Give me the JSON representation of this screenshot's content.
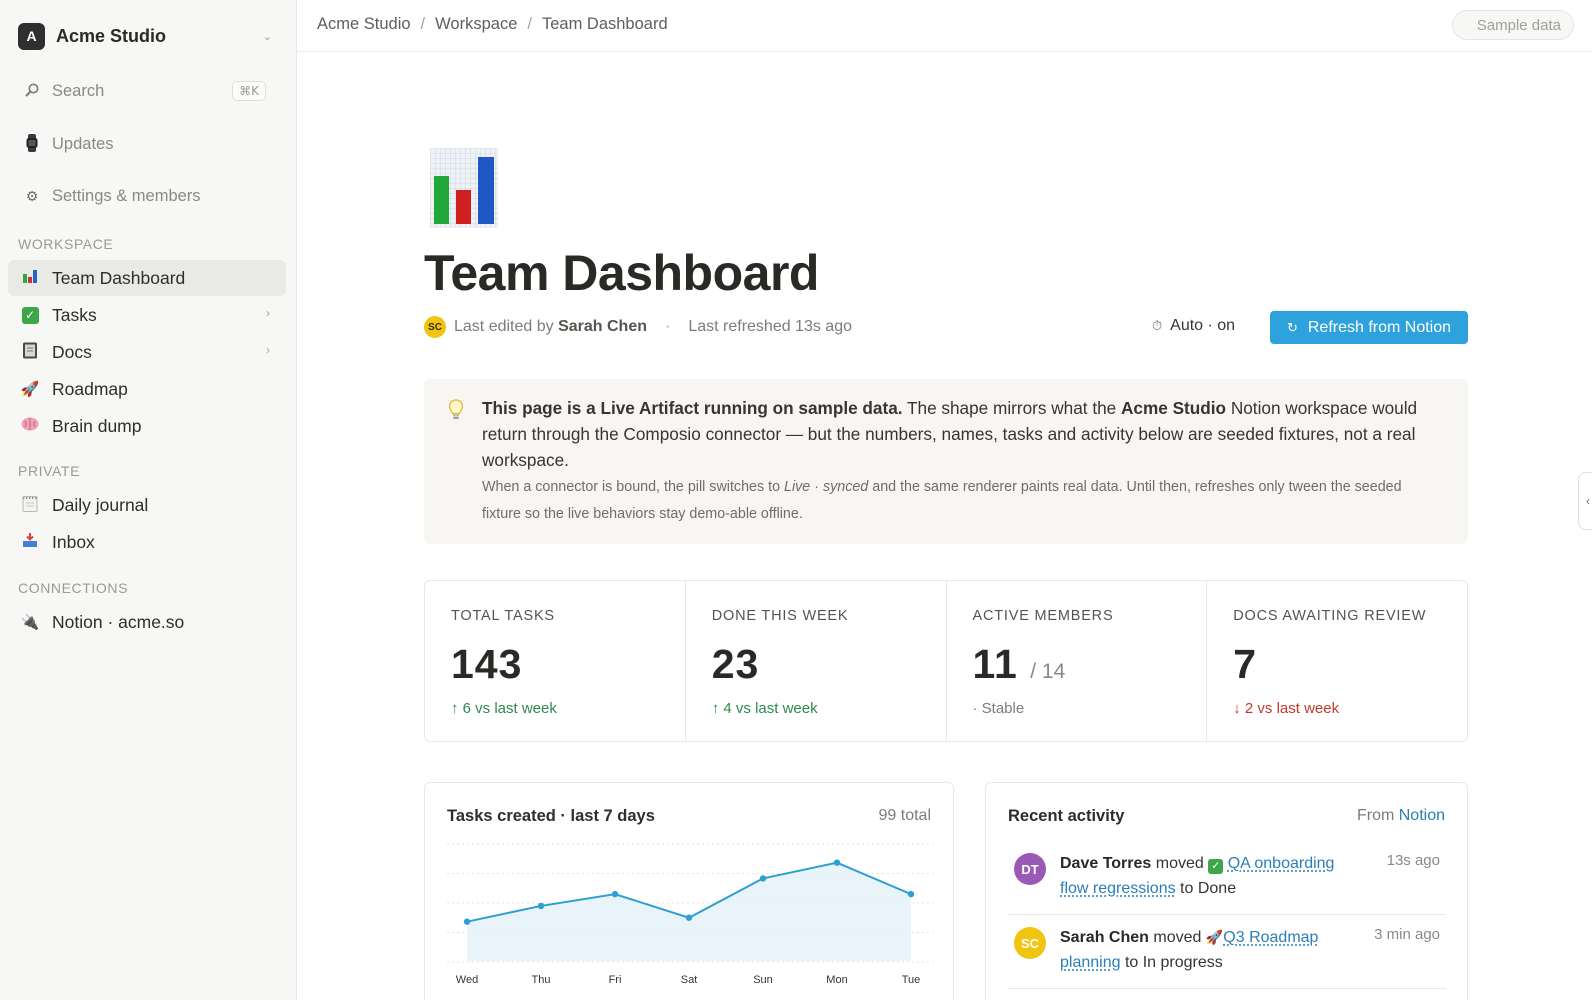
{
  "sidebar": {
    "workspace_initial": "A",
    "workspace_name": "Acme Studio",
    "search_label": "Search",
    "search_shortcut": "⌘K",
    "updates_label": "Updates",
    "settings_label": "Settings & members",
    "sections": {
      "workspace": "WORKSPACE",
      "private": "PRIVATE",
      "connections": "CONNECTIONS"
    },
    "workspace_items": [
      {
        "label": "Team Dashboard",
        "icon": "bar-chart-icon",
        "active": true
      },
      {
        "label": "Tasks",
        "icon": "check-box-icon"
      },
      {
        "label": "Docs",
        "icon": "notebook-icon"
      },
      {
        "label": "Roadmap",
        "icon": "rocket-icon"
      },
      {
        "label": "Brain dump",
        "icon": "brain-icon"
      }
    ],
    "private_items": [
      {
        "label": "Daily journal",
        "icon": "notepad-icon"
      },
      {
        "label": "Inbox",
        "icon": "inbox-tray-icon"
      }
    ],
    "connection_items": [
      {
        "label": "Notion · acme.so",
        "icon": "plug-icon"
      }
    ]
  },
  "topbar": {
    "breadcrumbs": [
      "Acme Studio",
      "Workspace",
      "Team Dashboard"
    ],
    "pill_label": "Sample data"
  },
  "page": {
    "title": "Team Dashboard",
    "editor_initials": "SC",
    "last_edited_prefix": "Last edited by",
    "last_edited_by": "Sarah Chen",
    "last_refreshed": "Last refreshed 13s ago",
    "auto_label": "Auto · on",
    "refresh_button": "Refresh from Notion"
  },
  "callout": {
    "bold_lead": "This page is a Live Artifact running on sample data.",
    "text_1": " The shape mirrors what the ",
    "workspace_bold": "Acme Studio",
    "text_2": " Notion workspace would return through the Composio connector — but the numbers, names, tasks and activity below are seeded fixtures, not a real workspace.",
    "sub_1": "When a connector is bound, the pill switches to ",
    "sub_live": "Live",
    "sub_dot": " · ",
    "sub_synced": "synced",
    "sub_2": " and the same renderer paints real data. Until then, refreshes only tween the seeded fixture so the live behaviors stay demo-able offline."
  },
  "stats": [
    {
      "label": "TOTAL TASKS",
      "value": "143",
      "trend": "↑ 6 vs last week",
      "trend_dir": "up"
    },
    {
      "label": "DONE THIS WEEK",
      "value": "23",
      "trend": "↑ 4 vs last week",
      "trend_dir": "up"
    },
    {
      "label": "ACTIVE MEMBERS",
      "value": "11",
      "denominator": "/ 14",
      "trend": "· Stable",
      "trend_dir": "neutral"
    },
    {
      "label": "DOCS AWAITING REVIEW",
      "value": "7",
      "trend": "↓ 2 vs last week",
      "trend_dir": "down"
    }
  ],
  "chart_card": {
    "title": "Tasks created · last 7 days",
    "total": "99 total"
  },
  "chart_data": {
    "type": "area",
    "categories": [
      "Wed",
      "Thu",
      "Fri",
      "Sat",
      "Sun",
      "Mon",
      "Tue"
    ],
    "values": [
      10,
      14,
      17,
      11,
      21,
      25,
      17
    ],
    "ylim": [
      0,
      30
    ],
    "grid": true,
    "color": "#2e9fcf"
  },
  "activity": {
    "title": "Recent activity",
    "from_prefix": "From",
    "from_source": "Notion",
    "items": [
      {
        "initials": "DT",
        "avatar_color": "#9b59b6",
        "actor": "Dave Torres",
        "verb": " moved ",
        "item_icon": "check-box-icon",
        "item": "QA onboarding flow regressions",
        "suffix": " to Done",
        "time": "13s ago"
      },
      {
        "initials": "SC",
        "avatar_color": "#f1c40f",
        "actor": "Sarah Chen",
        "verb": " moved ",
        "item_icon": "rocket-icon",
        "item": "Q3 Roadmap planning",
        "suffix": " to In progress",
        "time": "3 min ago"
      }
    ]
  }
}
